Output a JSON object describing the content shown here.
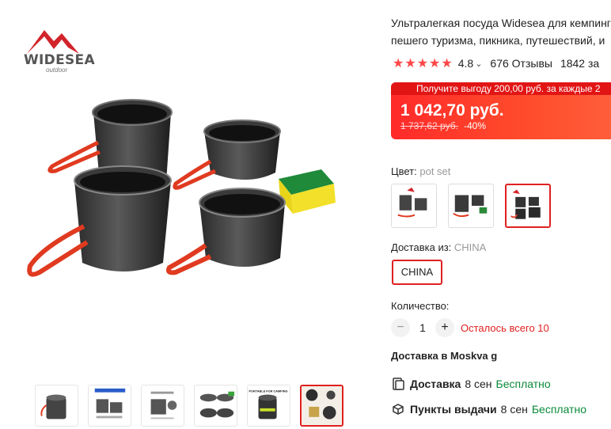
{
  "brand": {
    "name": "WIDESEA",
    "tagline": "outdoor"
  },
  "product": {
    "title_line1": "Ультралегкая посуда Widesea для кемпинга",
    "title_line2": "пешего туризма, пикника, путешествий, и",
    "rating": "4.8",
    "stars_icon": "★★★★★",
    "reviews": "676 Отзывы",
    "sold": "1842 за"
  },
  "price": {
    "promo": "Получите выгоду 200,00 руб. за каждые 2",
    "current": "1 042,70 руб.",
    "old": "1 737,62 руб.",
    "discount": "-40%"
  },
  "color": {
    "label": "Цвет:",
    "value": "pot set"
  },
  "shipping_from": {
    "label": "Доставка из:",
    "value": "CHINA",
    "option": "CHINA"
  },
  "quantity": {
    "label": "Количество:",
    "minus": "−",
    "value": "1",
    "plus": "+",
    "stock": "Осталось всего 10"
  },
  "delivery": {
    "heading": "Доставка в Moskva g",
    "courier": {
      "name": "Доставка",
      "eta": "8 сен",
      "price": "Бесплатно"
    },
    "pickup": {
      "name": "Пункты выдачи",
      "eta": "8 сен",
      "price": "Бесплатно"
    }
  },
  "thumbnails": {
    "count": 6,
    "active_index": 5,
    "thumb5_text": "PORTABLE FOR CAMPING"
  },
  "swatches": {
    "count": 3,
    "active_index": 2
  },
  "colors": {
    "accent": "#e02020",
    "price_gradient": "#ff2a2a",
    "free": "#0a8a3a"
  }
}
